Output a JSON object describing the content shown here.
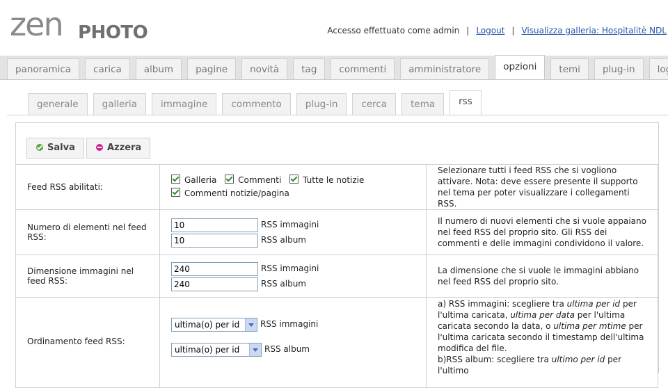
{
  "brand": {
    "zen": "zen",
    "photo": "PHOTO"
  },
  "userbar": {
    "logged_in": "Accesso effettuato come admin",
    "logout": "Logout",
    "view_gallery": "Visualizza galleria: Hospitalitè NDL"
  },
  "main_tabs": [
    "panoramica",
    "carica",
    "album",
    "pagine",
    "novità",
    "tag",
    "commenti",
    "amministratore",
    "opzioni",
    "temi",
    "plug-in",
    "log"
  ],
  "main_tabs_active": "opzioni",
  "sub_tabs": [
    "generale",
    "galleria",
    "immagine",
    "commento",
    "plug-in",
    "cerca",
    "tema",
    "rss"
  ],
  "sub_tabs_active": "rss",
  "buttons": {
    "save": "Salva",
    "reset": "Azzera"
  },
  "rows": {
    "feeds": {
      "label": "Feed RSS abilitati:",
      "options": [
        "Galleria",
        "Commenti",
        "Tutte le notizie",
        "Commenti notizie/pagina"
      ],
      "description": "Selezionare tutti i feed RSS che si vogliono attivare. Nota: deve essere presente il supporto nel tema per poter visualizzare i collegamenti RSS."
    },
    "count": {
      "label": "Numero di elementi nel feed RSS:",
      "images_value": "10",
      "images_unit": "RSS immagini",
      "albums_value": "10",
      "albums_unit": "RSS album",
      "description": "Il numero di nuovi elementi che si vuole appaiano nel feed RSS del proprio sito. Gli RSS dei commenti e delle immagini condividono il valore."
    },
    "size": {
      "label": "Dimensione immagini nel feed RSS:",
      "images_value": "240",
      "images_unit": "RSS immagini",
      "albums_value": "240",
      "albums_unit": "RSS album",
      "description": "La dimensione che si vuole le immagini abbiano nel feed RSS del proprio sito."
    },
    "order": {
      "label": "Ordinamento feed RSS:",
      "images_value": "ultima(o) per id",
      "images_unit": "RSS immagini",
      "albums_value": "ultima(o) per id",
      "albums_unit": "RSS album",
      "desc_a_1": "a) RSS immagini: scegliere tra ",
      "desc_a_2": "ultima per id",
      "desc_a_3": " per l'ultima caricata, ",
      "desc_a_4": "ultima per data",
      "desc_a_5": " per l'ultima caricata secondo la data, o ",
      "desc_a_6": "ultima per mtime",
      "desc_a_7": " per l'ultima caricata secondo il timestamp dell'ultima modifica del file.",
      "desc_b_1": "b)RSS album: scegliere tra ",
      "desc_b_2": "ultimo per id",
      "desc_b_3": " per l'ultimo"
    }
  }
}
